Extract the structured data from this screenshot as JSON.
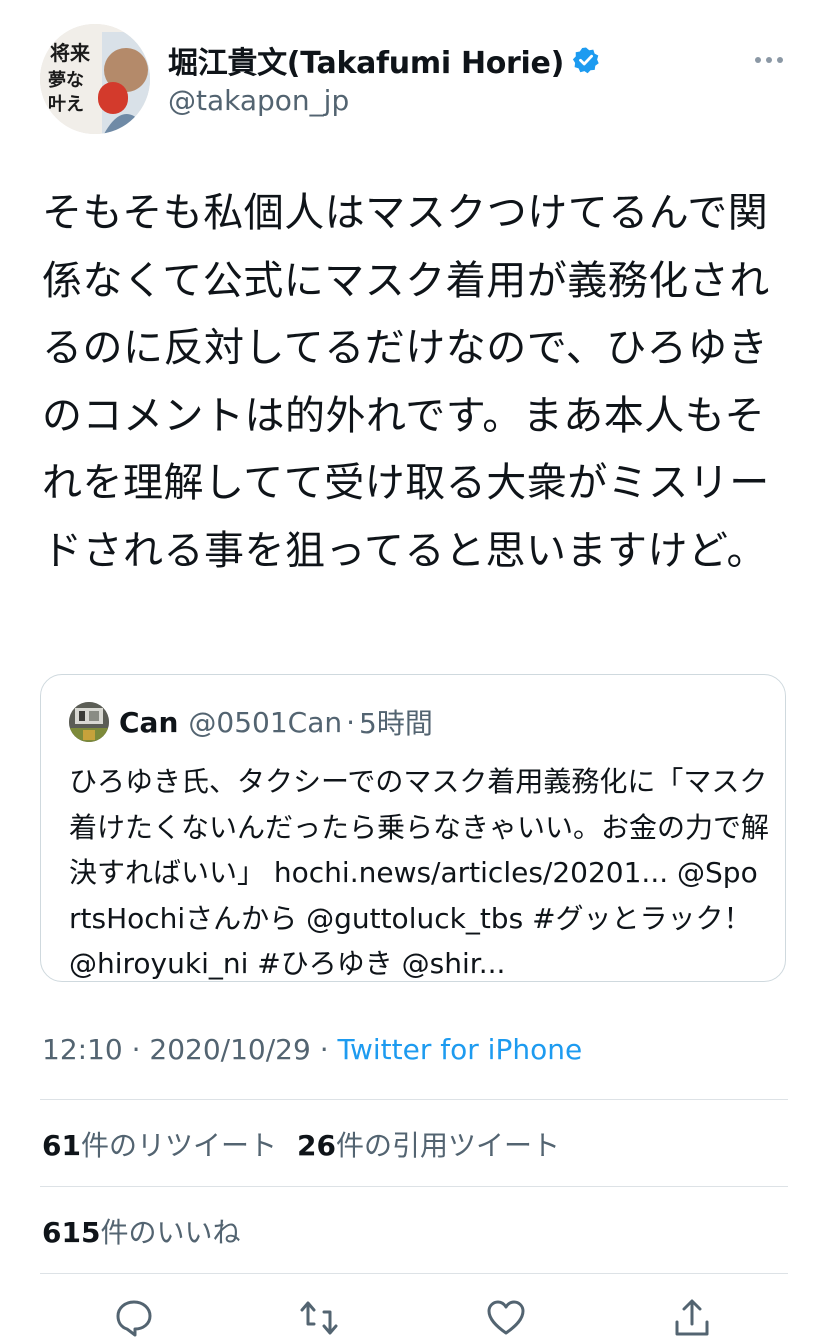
{
  "author": {
    "display_name": "堀江貴文(Takafumi Horie)",
    "handle": "@takapon_jp",
    "verified": true,
    "avatar_icon": "avatar-book-cover",
    "avatar_book_title": "将来の夢なんか、いま叶えろ。"
  },
  "tweet": {
    "text": "そもそも私個人はマスクつけてるんで関係なくて公式にマスク着用が義務化されるのに反対してるだけなので、ひろゆきのコメントは的外れです。まあ本人もそれを理解してて受け取る大衆がミスリードされる事を狙ってると思いますけど。"
  },
  "quoted_tweet": {
    "name": "Can",
    "handle": "@0501Can",
    "separator": "·",
    "time": "5時間",
    "text": "ひろゆき氏、タクシーでのマスク着用義務化に「マスク着けたくないんだったら乗らなきゃいい。お金の力で解決すればいい」 hochi.news/articles/20201... @SportsHochiさんから @guttoluck_tbs #グッとラック！@hiroyuki_ni #ひろゆき @shir..."
  },
  "meta": {
    "time": "12:10",
    "sep1": "·",
    "date": "2020/10/29",
    "sep2": "·",
    "source": "Twitter for iPhone"
  },
  "stats": {
    "retweets_count": "61",
    "retweets_label": "件のリツイート",
    "quotes_count": "26",
    "quotes_label": "件の引用ツイート",
    "likes_count": "615",
    "likes_label": "件のいいね"
  },
  "colors": {
    "link": "#1d9bf0",
    "secondary_text": "#536471",
    "verified_badge": "#1d9bf0"
  },
  "icons": [
    "more-icon",
    "verified-badge-icon",
    "reply-icon",
    "retweet-icon",
    "like-icon",
    "share-icon"
  ]
}
